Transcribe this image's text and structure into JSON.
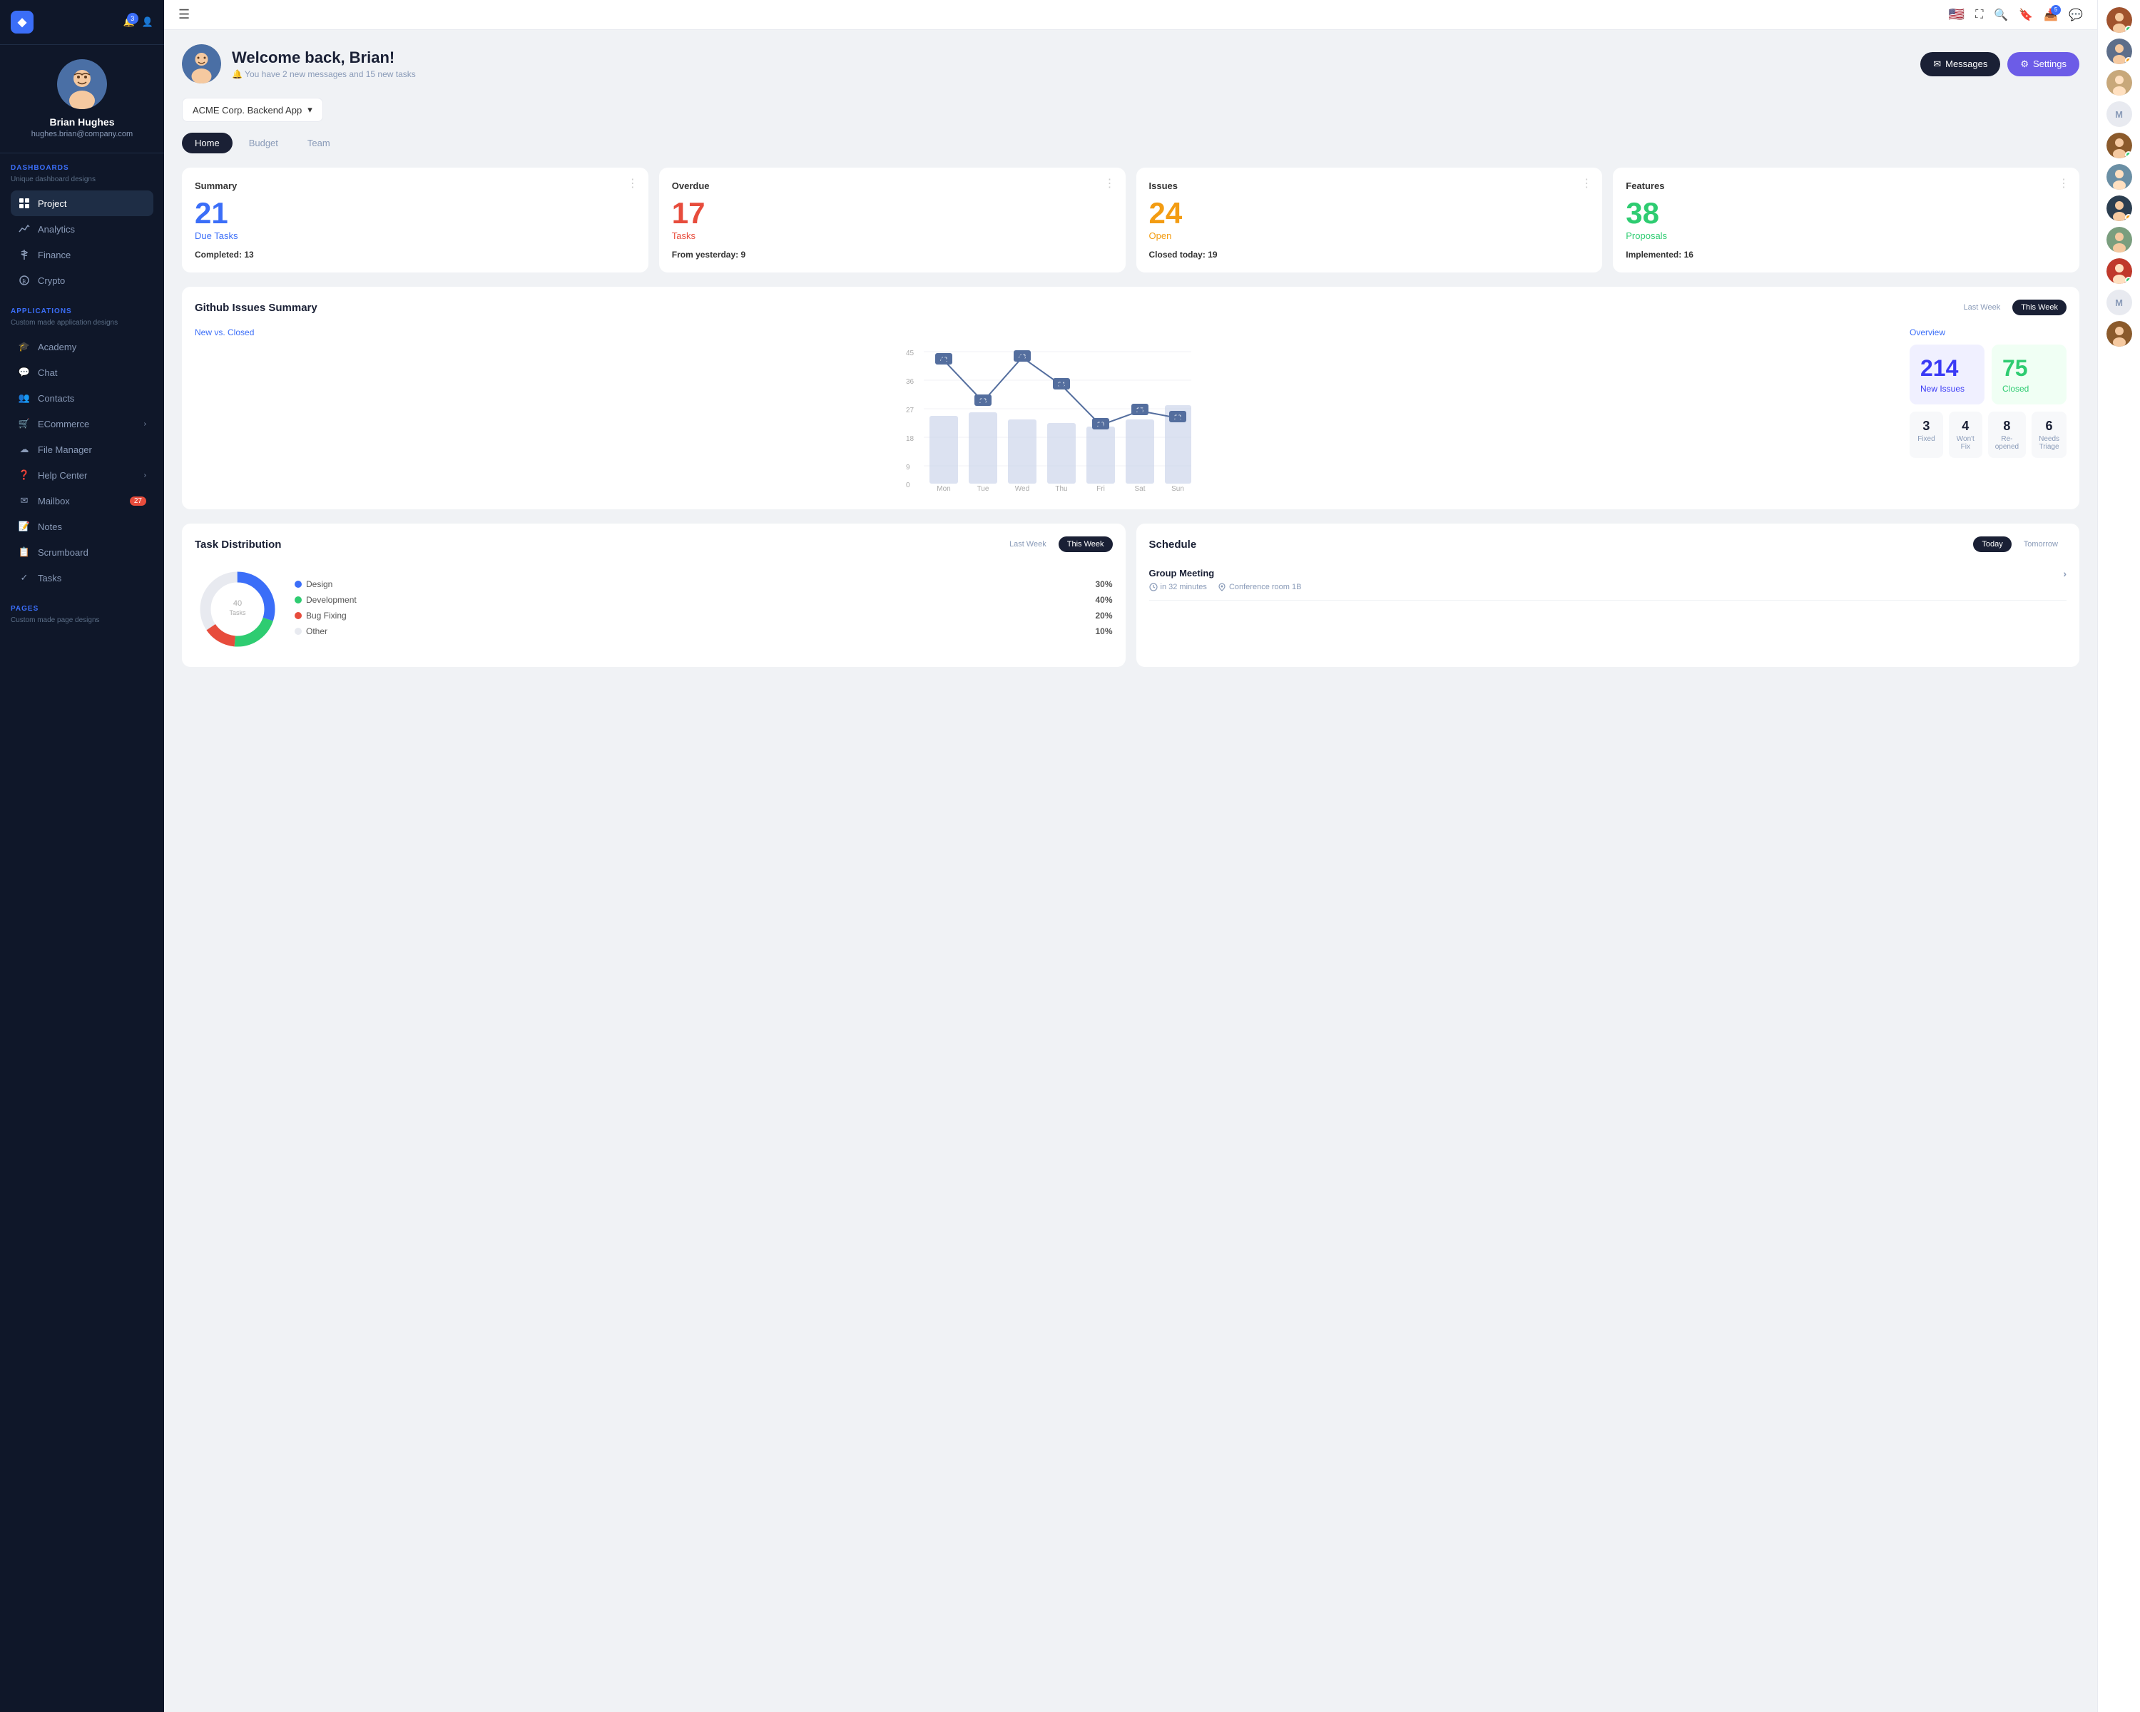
{
  "app": {
    "logo": "◆",
    "notifications_badge": "3"
  },
  "user": {
    "name": "Brian Hughes",
    "email": "hughes.brian@company.com"
  },
  "topbar": {
    "hamburger": "☰",
    "flag": "🇺🇸",
    "inbox_badge": "5"
  },
  "welcome": {
    "greeting": "Welcome back, Brian!",
    "subtitle": "🔔 You have 2 new messages and 15 new tasks",
    "messages_btn": "Messages",
    "settings_btn": "Settings"
  },
  "project_selector": {
    "label": "ACME Corp. Backend App"
  },
  "tabs": [
    "Home",
    "Budget",
    "Team"
  ],
  "active_tab": "Home",
  "stats": [
    {
      "title": "Summary",
      "number": "21",
      "label": "Due Tasks",
      "sub_label": "Completed:",
      "sub_value": "13",
      "color": "blue"
    },
    {
      "title": "Overdue",
      "number": "17",
      "label": "Tasks",
      "sub_label": "From yesterday:",
      "sub_value": "9",
      "color": "red"
    },
    {
      "title": "Issues",
      "number": "24",
      "label": "Open",
      "sub_label": "Closed today:",
      "sub_value": "19",
      "color": "orange"
    },
    {
      "title": "Features",
      "number": "38",
      "label": "Proposals",
      "sub_label": "Implemented:",
      "sub_value": "16",
      "color": "green"
    }
  ],
  "github_issues": {
    "title": "Github Issues Summary",
    "week_options": [
      "Last Week",
      "This Week"
    ],
    "active_week": "This Week",
    "chart_subtitle": "New vs. Closed",
    "overview_label": "Overview",
    "new_issues": "214",
    "new_issues_label": "New Issues",
    "closed": "75",
    "closed_label": "Closed",
    "sub_stats": [
      {
        "number": "3",
        "label": "Fixed"
      },
      {
        "number": "4",
        "label": "Won't Fix"
      },
      {
        "number": "8",
        "label": "Re-opened"
      },
      {
        "number": "6",
        "label": "Needs Triage"
      }
    ],
    "chart_data": {
      "days": [
        "Mon",
        "Tue",
        "Wed",
        "Thu",
        "Fri",
        "Sat",
        "Sun"
      ],
      "line_values": [
        42,
        28,
        43,
        34,
        20,
        25,
        22
      ],
      "bar_values": [
        30,
        32,
        28,
        25,
        22,
        28,
        38
      ]
    }
  },
  "task_distribution": {
    "title": "Task Distribution",
    "week_options": [
      "Last Week",
      "This Week"
    ],
    "active_week": "This Week",
    "chart_label": "40"
  },
  "schedule": {
    "title": "Schedule",
    "day_options": [
      "Today",
      "Tomorrow"
    ],
    "active_day": "Today",
    "items": [
      {
        "title": "Group Meeting",
        "time": "in 32 minutes",
        "location": "Conference room 1B"
      }
    ]
  },
  "sidebar_nav": {
    "dashboards_label": "DASHBOARDS",
    "dashboards_sub": "Unique dashboard designs",
    "dashboards_items": [
      {
        "label": "Project",
        "icon": "project"
      },
      {
        "label": "Analytics",
        "icon": "analytics"
      },
      {
        "label": "Finance",
        "icon": "finance"
      },
      {
        "label": "Crypto",
        "icon": "crypto"
      }
    ],
    "applications_label": "APPLICATIONS",
    "applications_sub": "Custom made application designs",
    "applications_items": [
      {
        "label": "Academy",
        "icon": "academy"
      },
      {
        "label": "Chat",
        "icon": "chat"
      },
      {
        "label": "Contacts",
        "icon": "contacts"
      },
      {
        "label": "ECommerce",
        "icon": "ecommerce",
        "arrow": true
      },
      {
        "label": "File Manager",
        "icon": "file"
      },
      {
        "label": "Help Center",
        "icon": "help",
        "arrow": true
      },
      {
        "label": "Mailbox",
        "icon": "mail",
        "badge": "27"
      },
      {
        "label": "Notes",
        "icon": "notes"
      },
      {
        "label": "Scrumboard",
        "icon": "scrumboard"
      },
      {
        "label": "Tasks",
        "icon": "tasks"
      }
    ],
    "pages_label": "PAGES",
    "pages_sub": "Custom made page designs"
  },
  "right_panel": {
    "avatars": [
      {
        "type": "person",
        "dot": "green"
      },
      {
        "type": "person",
        "dot": "orange"
      },
      {
        "type": "person",
        "dot": "none"
      },
      {
        "type": "placeholder",
        "letter": "M",
        "dot": "none"
      },
      {
        "type": "person",
        "dot": "green"
      },
      {
        "type": "person",
        "dot": "none"
      },
      {
        "type": "person",
        "dot": "orange"
      },
      {
        "type": "person",
        "dot": "none"
      },
      {
        "type": "person",
        "dot": "green"
      },
      {
        "type": "placeholder",
        "letter": "M",
        "dot": "none"
      },
      {
        "type": "person",
        "dot": "none"
      }
    ]
  }
}
